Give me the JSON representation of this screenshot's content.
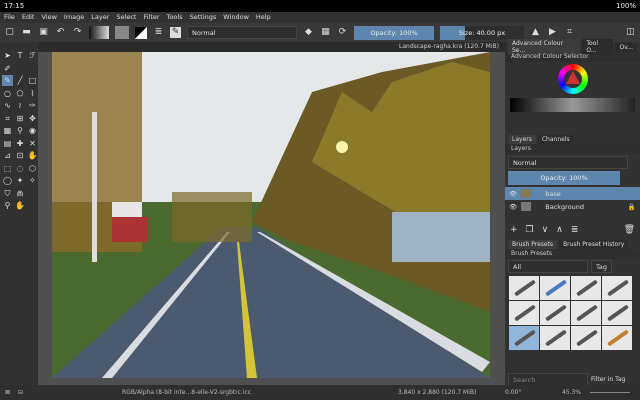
{
  "status": {
    "time": "17:15",
    "battery": "100%"
  },
  "menu": [
    "File",
    "Edit",
    "View",
    "Image",
    "Layer",
    "Select",
    "Filter",
    "Tools",
    "Settings",
    "Window",
    "Help"
  ],
  "toolbar": {
    "blend_mode": "Normal",
    "opacity": "Opacity: 100%",
    "size": "Size: 40.00 px"
  },
  "document": {
    "tab": "Landscape-ragha.kra (120.7 MiB)"
  },
  "right_tabs": [
    "Advanced Colour Se...",
    "Tool O...",
    "Ov..."
  ],
  "colour_selector": {
    "title": "Advanced Colour Selector"
  },
  "layers": {
    "tabs": [
      "Layers",
      "Channels"
    ],
    "title": "Layers",
    "blend": "Normal",
    "opacity": "Opacity: 100%",
    "items": [
      {
        "name": "base",
        "selected": true
      },
      {
        "name": "Background",
        "selected": false,
        "locked": true
      }
    ]
  },
  "brushes": {
    "tabs": [
      "Brush Presets",
      "Brush Preset History"
    ],
    "title": "Brush Presets",
    "filter": "All",
    "tag": "Tag",
    "search_placeholder": "Search",
    "filter_in_tag": "Filter in Tag"
  },
  "bottom": {
    "color_info": "RGB/Alpha (8-bit inte...8-elle-V2-srgbtrc.icc",
    "dimensions": "3,840 x 2,880 (120.7 MiB)",
    "rotation": "0.00°",
    "zoom": "45.3%"
  },
  "colors": {
    "accent": "#5d85ad",
    "panel": "#323232"
  }
}
